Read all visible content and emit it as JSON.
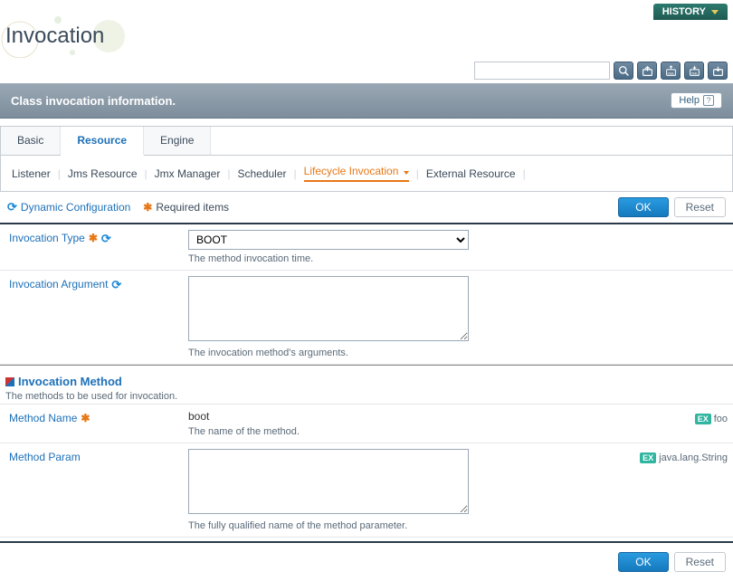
{
  "topbar": {
    "history": "HISTORY"
  },
  "page_title": "Invocation",
  "section_header": "Class invocation information.",
  "help_label": "Help",
  "tabs": {
    "basic": "Basic",
    "resource": "Resource",
    "engine": "Engine"
  },
  "subnav": {
    "listener": "Listener",
    "jms": "Jms Resource",
    "jmx": "Jmx Manager",
    "scheduler": "Scheduler",
    "lifecycle": "Lifecycle Invocation",
    "external": "External Resource"
  },
  "legend": {
    "dynamic": "Dynamic Configuration",
    "required": "Required items"
  },
  "buttons": {
    "ok": "OK",
    "reset": "Reset"
  },
  "fields": {
    "invocation_type": {
      "label": "Invocation Type",
      "value": "BOOT",
      "hint": "The method invocation time."
    },
    "invocation_argument": {
      "label": "Invocation Argument",
      "value": "",
      "hint": "The invocation method's arguments."
    }
  },
  "subsection": {
    "title": "Invocation Method",
    "desc": "The methods to be used for invocation."
  },
  "method_fields": {
    "name": {
      "label": "Method Name",
      "value": "boot",
      "hint": "The name of the method.",
      "example": "foo"
    },
    "param": {
      "label": "Method Param",
      "value": "",
      "hint": "The fully qualified name of the method parameter.",
      "example": "java.lang.String"
    }
  },
  "example_badge": "EX"
}
